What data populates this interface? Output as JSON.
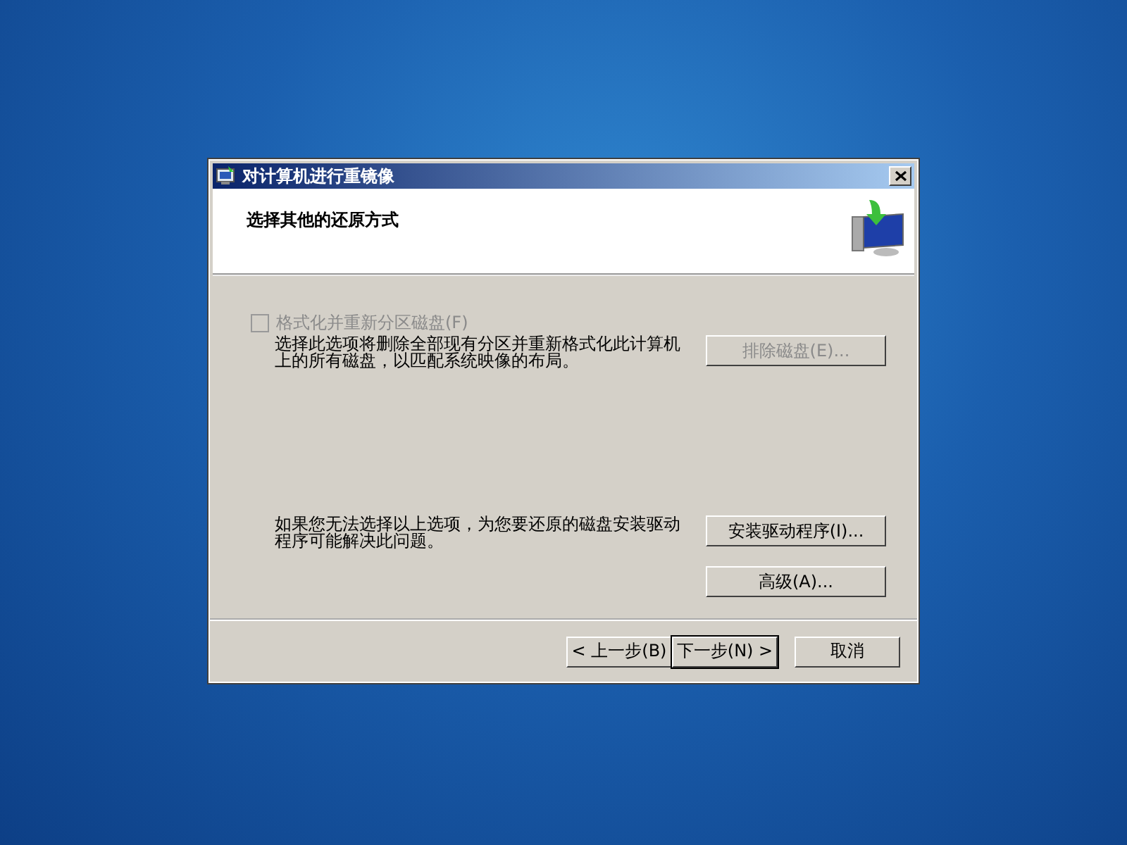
{
  "window": {
    "title": "对计算机进行重镜像"
  },
  "header": {
    "title": "选择其他的还原方式"
  },
  "format_option": {
    "label": "格式化并重新分区磁盘(F)",
    "checked": false,
    "disabled": true,
    "description": "选择此选项将删除全部现有分区并重新格式化此计算机上的所有磁盘，以匹配系统映像的布局。",
    "button": {
      "label": "排除磁盘(E)...",
      "disabled": true
    }
  },
  "driver_section": {
    "description": "如果您无法选择以上选项，为您要还原的磁盘安装驱动程序可能解决此问题。",
    "buttons": [
      {
        "label": "安装驱动程序(I)...",
        "disabled": false
      },
      {
        "label": "高级(A)...",
        "disabled": false
      }
    ]
  },
  "footer_buttons": [
    {
      "label": "< 上一步(B)",
      "default": false
    },
    {
      "label": "下一步(N) >",
      "default": true
    },
    {
      "label": "取消",
      "default": false
    }
  ]
}
